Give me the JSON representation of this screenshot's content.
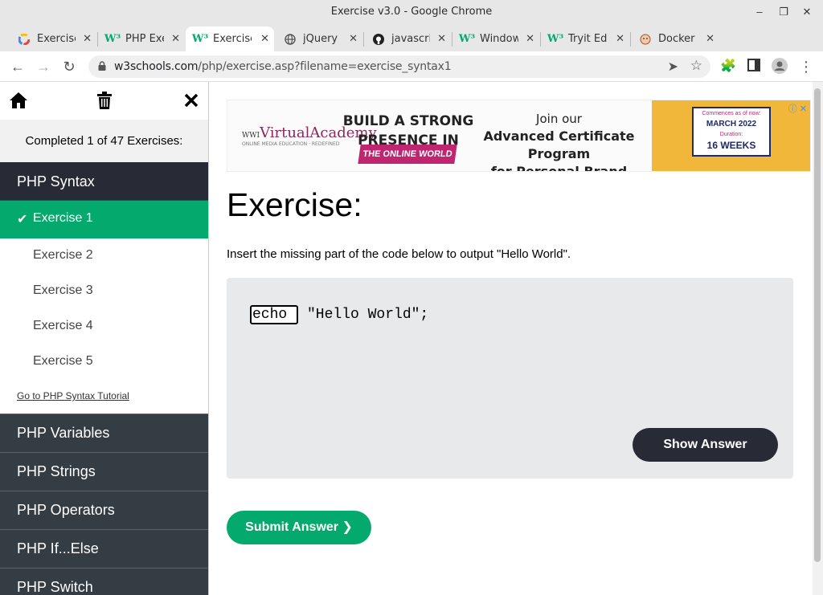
{
  "window": {
    "title": "Exercise v3.0 - Google Chrome"
  },
  "tabs": [
    {
      "label": "Exercise",
      "icon": "colorful-c-icon"
    },
    {
      "label": "PHP Exe",
      "icon": "w3schools-icon"
    },
    {
      "label": "Exercise",
      "icon": "w3schools-icon",
      "active": true
    },
    {
      "label": "jQuery",
      "icon": "globe-icon"
    },
    {
      "label": "javascri",
      "icon": "github-icon"
    },
    {
      "label": "Window",
      "icon": "w3schools-icon"
    },
    {
      "label": "Tryit Edi",
      "icon": "w3schools-icon"
    },
    {
      "label": "Docker",
      "icon": "docker-face-icon"
    }
  ],
  "address_bar": {
    "url_host": "w3schools.com",
    "url_path": "/php/exercise.asp?filename=exercise_syntax1"
  },
  "sidebar": {
    "completed_text": "Completed 1 of 47 Exercises:",
    "current_section": "PHP Syntax",
    "exercises": [
      "Exercise 1",
      "Exercise 2",
      "Exercise 3",
      "Exercise 4",
      "Exercise 5"
    ],
    "tutorial_link": "Go to PHP Syntax Tutorial",
    "other_sections": [
      "PHP Variables",
      "PHP Strings",
      "PHP Operators",
      "PHP If...Else",
      "PHP Switch"
    ]
  },
  "ad": {
    "logo": "VirtualAcademy",
    "logo_prefix": "WWI",
    "logo_tag": "ONLINE MEDIA EDUCATION · REDEFINED",
    "headline_1": "BUILD A STRONG",
    "headline_2": "PRESENCE IN",
    "badge": "THE ONLINE WORLD",
    "join_line": "Join our",
    "program_line_1": "Advanced Certificate Program",
    "program_line_2": "for Personal Brand Building",
    "card_top": "Commences as of now:",
    "card_month": "MARCH 2022",
    "card_duration_label": "Duration:",
    "card_weeks": "16 WEEKS"
  },
  "main": {
    "heading": "Exercise:",
    "instruction": "Insert the missing part of the code below to output \"Hello World\".",
    "code_input_value": "echo",
    "code_rest": "\"Hello World\";",
    "show_answer_label": "Show Answer",
    "submit_label": "Submit Answer ❯"
  },
  "colors": {
    "accent_green": "#04aa6d",
    "dark": "#282a35",
    "section_dark": "#353d44"
  }
}
